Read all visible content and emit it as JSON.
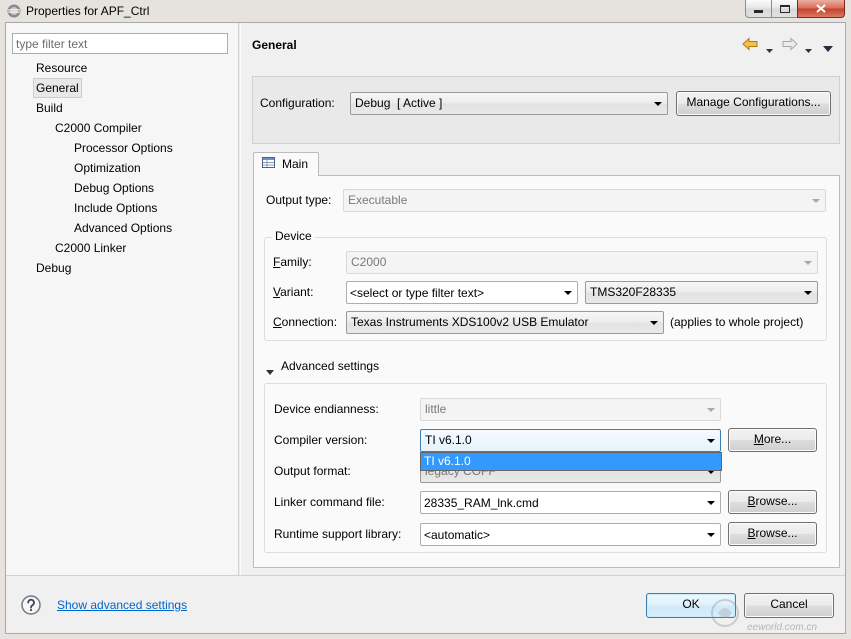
{
  "window": {
    "title": "Properties for APF_Ctrl"
  },
  "filter": {
    "placeholder": "type filter text"
  },
  "tree": [
    {
      "label": "Resource"
    },
    {
      "label": "General",
      "selected": true
    },
    {
      "label": "Build",
      "expanded": true,
      "children": [
        {
          "label": "C2000 Compiler",
          "expanded": true,
          "children": [
            {
              "label": "Processor Options"
            },
            {
              "label": "Optimization"
            },
            {
              "label": "Debug Options"
            },
            {
              "label": "Include Options"
            },
            {
              "label": "Advanced Options"
            }
          ]
        },
        {
          "label": "C2000 Linker"
        }
      ]
    },
    {
      "label": "Debug"
    }
  ],
  "page": {
    "title": "General"
  },
  "configuration": {
    "label": "Configuration:",
    "value": "Debug  [ Active ]",
    "manage_button": "Manage Configurations..."
  },
  "tabs": [
    {
      "label": "Main",
      "active": true
    }
  ],
  "main": {
    "output_type": {
      "label": "Output type:",
      "value": "Executable",
      "disabled": true
    },
    "device": {
      "group_label": "Device",
      "family": {
        "label": "Family:",
        "value": "C2000",
        "disabled": true
      },
      "variant": {
        "label": "Variant:",
        "filter_text": "<select or type filter text>",
        "value": "TMS320F28335"
      },
      "connection": {
        "label": "Connection:",
        "value": "Texas Instruments XDS100v2 USB Emulator",
        "note": "(applies to whole project)"
      }
    },
    "advanced": {
      "label": "Advanced settings",
      "expanded": true,
      "endianness": {
        "label": "Device endianness:",
        "value": "little",
        "disabled": true
      },
      "compiler_version": {
        "label": "Compiler version:",
        "value": "TI v6.1.0",
        "dropdown_open": true,
        "options": [
          "TI v6.1.0"
        ],
        "button": "More..."
      },
      "output_format": {
        "label": "Output format:",
        "value": "legacy COFF"
      },
      "linker_cmd": {
        "label": "Linker command file:",
        "value": "28335_RAM_lnk.cmd",
        "button": "Browse..."
      },
      "rts_library": {
        "label": "Runtime support library:",
        "value": "<automatic>",
        "button": "Browse..."
      }
    }
  },
  "footer": {
    "help_link": "Show advanced settings",
    "ok": "OK",
    "cancel": "Cancel"
  },
  "watermark": {
    "text_cn": "电子工程世界",
    "text_en": "eeworld.com.cn"
  },
  "colors": {
    "selection": "#3399ff",
    "link": "#0066cc",
    "focus_border": "#3c7fb1",
    "close_button": "#c75050",
    "back_arrow": "#f5c04a"
  },
  "icons": {
    "app": "eclipse-icon",
    "minimize": "minimize-icon",
    "maximize": "maximize-icon",
    "close": "close-icon",
    "back": "back-arrow-icon",
    "forward": "forward-arrow-icon",
    "view_menu": "view-menu-icon",
    "tab": "table-icon",
    "expand": "chevron-down-icon",
    "help": "help-icon"
  }
}
